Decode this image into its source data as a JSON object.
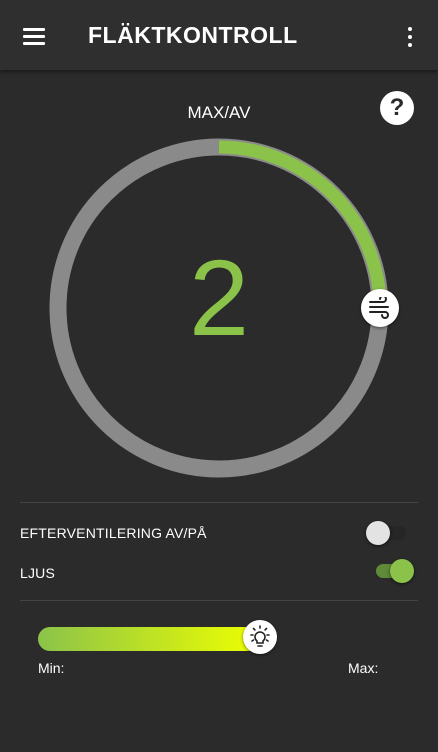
{
  "app_bar": {
    "title": "FLÄKTKONTROLL",
    "menu_icon": "menu-icon",
    "overflow_icon": "more-vert-icon"
  },
  "fan": {
    "mode_label": "MAX/AV",
    "help_label": "?",
    "speed_value": "2",
    "speed_fraction": 0.25,
    "knob_icon": "wind-icon",
    "accent_color": "#8bc34a",
    "track_color": "#8a8a8a"
  },
  "settings": {
    "post_ventilation": {
      "label": "EFTERVENTILERING AV/PÅ",
      "enabled": false
    },
    "light": {
      "label": "LJUS",
      "enabled": true
    }
  },
  "light_level": {
    "fraction": 0.65,
    "min_label": "Min:",
    "max_label": "Max:",
    "thumb_icon": "lightbulb-icon",
    "gradient_start": "#8bc34a",
    "gradient_end": "#eeff00"
  }
}
